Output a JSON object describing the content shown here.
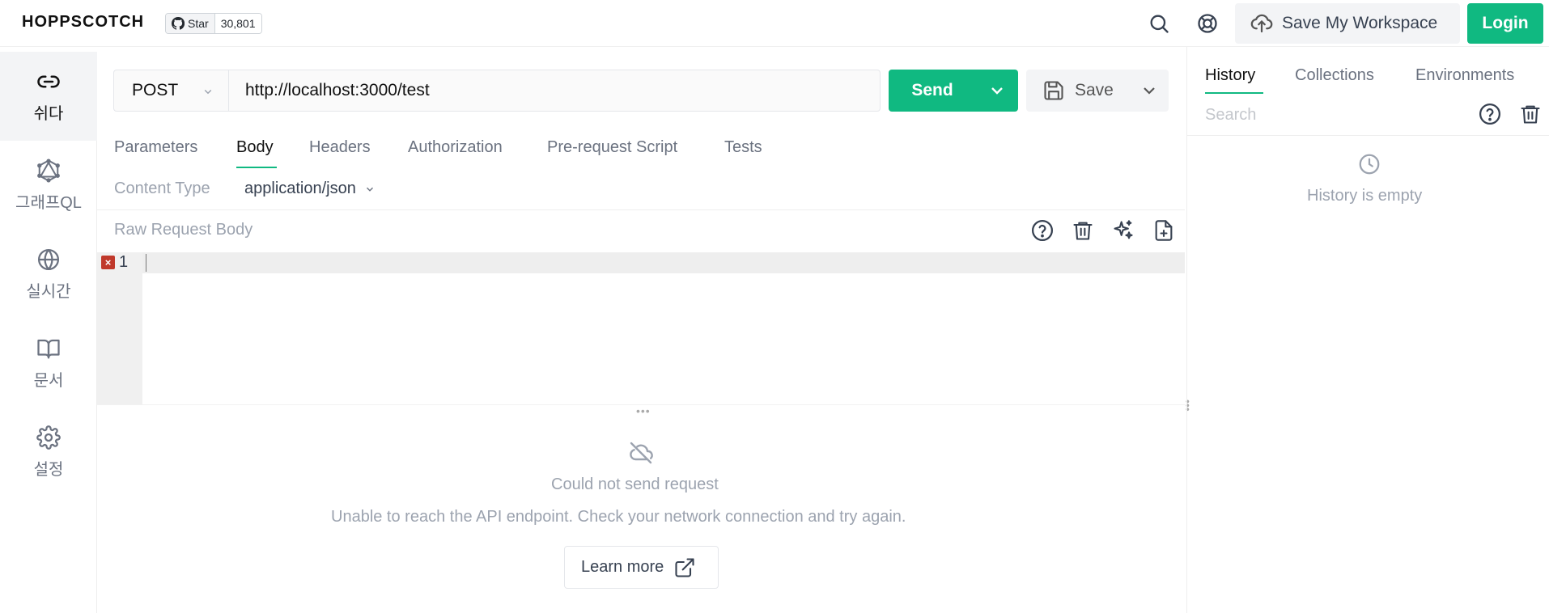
{
  "header": {
    "brand": "HOPPSCOTCH",
    "github_star_label": "Star",
    "github_star_count": "30,801",
    "save_workspace_label": "Save My Workspace",
    "login_label": "Login"
  },
  "sidebar": {
    "items": [
      {
        "label": "쉬다",
        "icon": "link-icon"
      },
      {
        "label": "그래프QL",
        "icon": "graphql-icon"
      },
      {
        "label": "실시간",
        "icon": "globe-icon"
      },
      {
        "label": "문서",
        "icon": "book-icon"
      },
      {
        "label": "설정",
        "icon": "gear-icon"
      }
    ]
  },
  "request": {
    "method": "POST",
    "url": "http://localhost:3000/test",
    "send_label": "Send",
    "save_label": "Save"
  },
  "tabs": [
    "Parameters",
    "Body",
    "Headers",
    "Authorization",
    "Pre-request Script",
    "Tests"
  ],
  "body": {
    "content_type_label": "Content Type",
    "content_type_value": "application/json",
    "raw_label": "Raw Request Body",
    "line_number": "1",
    "error_marker": "×"
  },
  "response": {
    "title": "Could not send request",
    "description": "Unable to reach the API endpoint. Check your network connection and try again.",
    "learn_more_label": "Learn more"
  },
  "right_panel": {
    "tabs": [
      "History",
      "Collections",
      "Environments"
    ],
    "search_placeholder": "Search",
    "empty_text": "History is empty"
  },
  "colors": {
    "accent": "#10b981",
    "error": "#c0392b"
  }
}
